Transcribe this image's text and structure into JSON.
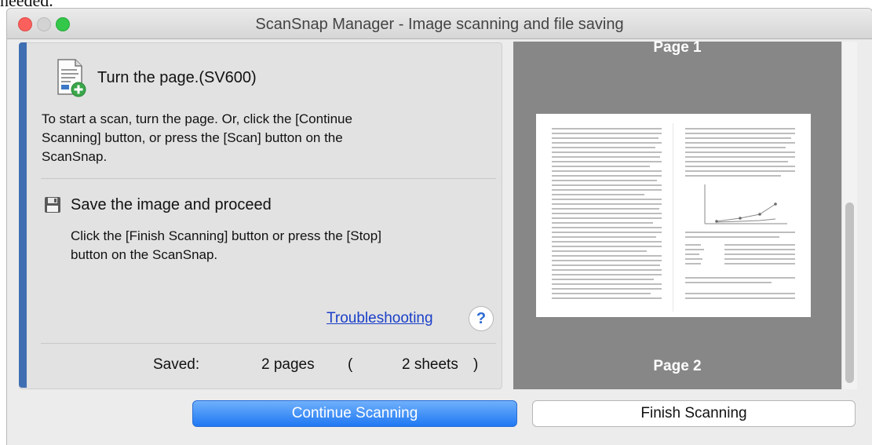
{
  "top_fragment": "needed.",
  "window": {
    "title": "ScanSnap Manager - Image scanning and file saving"
  },
  "step1": {
    "title": "Turn the page.(SV600)",
    "desc_lines": [
      "To start a scan, turn the page. Or, click the [Continue",
      "Scanning] button, or press the [Scan] button on the",
      "ScanSnap."
    ]
  },
  "step2": {
    "title": "Save the image and proceed",
    "desc_lines": [
      "Click the [Finish Scanning] button or press the [Stop]",
      "button on the ScanSnap."
    ]
  },
  "troubleshooting": {
    "label": "Troubleshooting",
    "help": "?"
  },
  "saved": {
    "label": "Saved:",
    "pages": "2 pages",
    "paren_open": "(",
    "sheets": "2 sheets",
    "paren_close": ")"
  },
  "preview": {
    "page1_label": "Page 1",
    "page2_label": "Page 2"
  },
  "buttons": {
    "continue": "Continue Scanning",
    "finish": "Finish Scanning"
  },
  "colors": {
    "accent": "#3f6fb2",
    "link": "#1a3fc9",
    "primary_button": "#1f78f3",
    "preview_bg": "#878787"
  },
  "icons": {
    "step1": "document-add-icon",
    "step2": "floppy-disk-icon",
    "help": "help-icon"
  }
}
